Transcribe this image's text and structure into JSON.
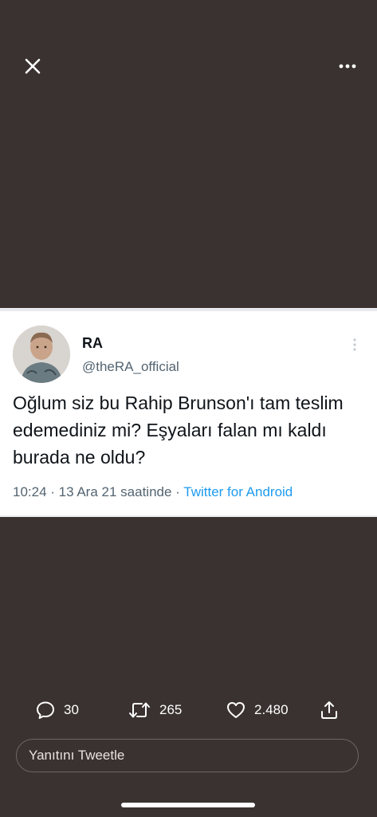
{
  "top_bar": {
    "close_icon": "close-icon",
    "more_icon": "more-horizontal-icon"
  },
  "tweet": {
    "author_name": "RA",
    "author_handle": "@theRA_official",
    "text": "Oğlum siz bu Rahip Brunson'ı tam teslim edemediniz mi? Eşyaları falan mı kaldı burada ne oldu?",
    "timestamp": "10:24 · 13 Ara 21 saatinde",
    "separator": " · ",
    "source": "Twitter for Android"
  },
  "actions": {
    "replies": "30",
    "retweets": "265",
    "likes": "2.480"
  },
  "reply_box": {
    "placeholder": "Yanıtını Tweetle"
  },
  "colors": {
    "background": "#3a3230",
    "card": "#ffffff",
    "link": "#1d9bf0",
    "secondary_text": "#536471"
  }
}
